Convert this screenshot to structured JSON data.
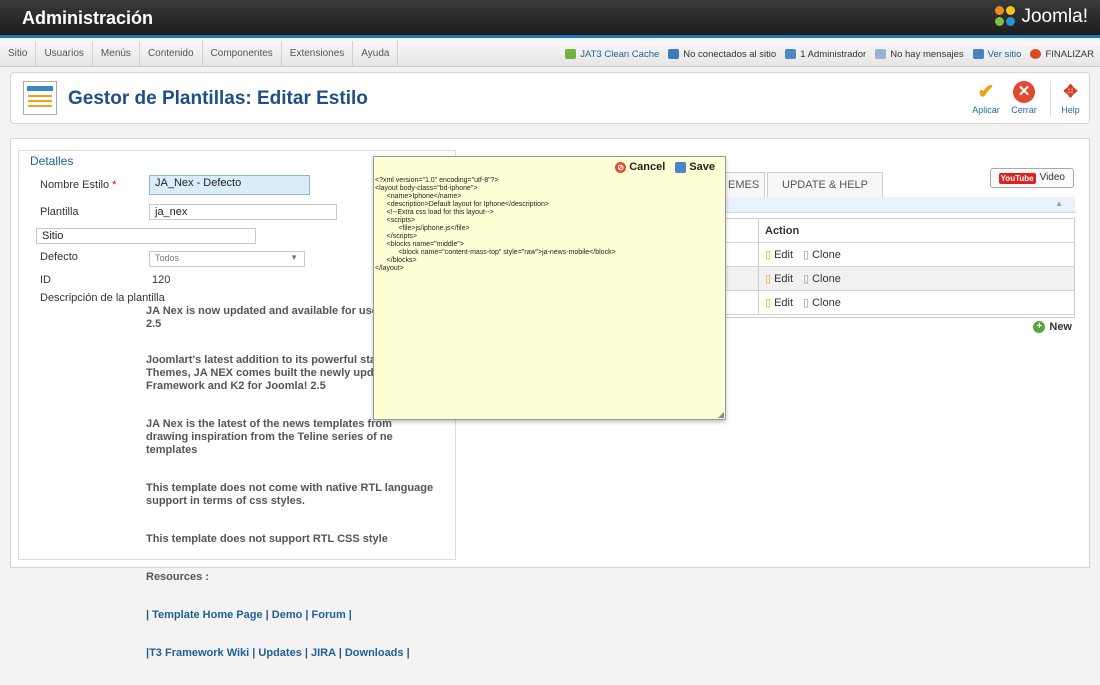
{
  "topbar": {
    "title": "Administración",
    "brand": "Joomla!"
  },
  "menu": [
    "Sitio",
    "Usuarios",
    "Menús",
    "Contenido",
    "Componentes",
    "Extensiones",
    "Ayuda"
  ],
  "status": {
    "cache": "JAT3 Clean Cache",
    "visitors": "No conectados al sitio",
    "admins": "1 Administrador",
    "messages": "No hay mensajes",
    "view_site": "Ver sitio",
    "logout": "FINALIZAR"
  },
  "toolbar": {
    "title": "Gestor de Plantillas: Editar Estilo",
    "apply": "Aplicar",
    "close": "Cerrar",
    "help": "Help"
  },
  "details": {
    "legend": "Detalles",
    "style_name_label": "Nombre Estilo",
    "required_mark": "*",
    "style_name": "JA_Nex - Defecto",
    "template_label": "Plantilla",
    "template_value": "ja_nex",
    "site_value": "Sitio",
    "default_label": "Defecto",
    "default_value": "Todos",
    "id_label": "ID",
    "id_value": "120",
    "description_label": "Descripción de la plantilla",
    "description": [
      "JA Nex is now updated and available for use\n2.5",
      "Joomlart's latest addition to its powerful stable\nThemes, JA NEX comes built the newly updated\nFramework and K2 for Joomla! 2.5",
      "JA Nex is the latest of the news templates from\ndrawing inspiration from the Teline series of ne\ntemplates",
      "This template does not come with native RTL language\nsupport in terms of css styles.",
      "This template does not support RTL CSS style",
      "Resources :"
    ],
    "links_line1": "| Template Home Page | Demo | Forum |",
    "links_line2": "|T3 Framework Wiki | Updates | JIRA | Downloads |"
  },
  "editor": {
    "cancel": "Cancel",
    "save": "Save",
    "content": "<?xml version=\"1.0\" encoding=\"utf-8\"?>\n<layout body-class=\"bd-iphone\">\n      <name>Iphone</name>\n      <description>Default layout for Iphone</description>\n      <!--Extra css load for this layout-->\n      <scripts>\n            <file>js/iphone.js</file>\n      </scripts>\n      <blocks name=\"middle\">\n            <block name=\"content-mass-top\" style=\"raw\">ja-news-mobile</block>\n      </blocks>\n</layout>"
  },
  "tabs": [
    "EMES",
    "UPDATE & HELP"
  ],
  "video": "Video",
  "youtube_badge": "YouTube",
  "table": {
    "header": "Action",
    "rows": [
      {
        "edit": "Edit",
        "clone": "Clone"
      },
      {
        "edit": "Edit",
        "clone": "Clone"
      },
      {
        "edit": "Edit",
        "clone": "Clone"
      }
    ],
    "new": "New"
  },
  "colors": {
    "accent": "#1d78b8",
    "title": "#1e4f88",
    "editor_bg": "#ffffd6"
  }
}
